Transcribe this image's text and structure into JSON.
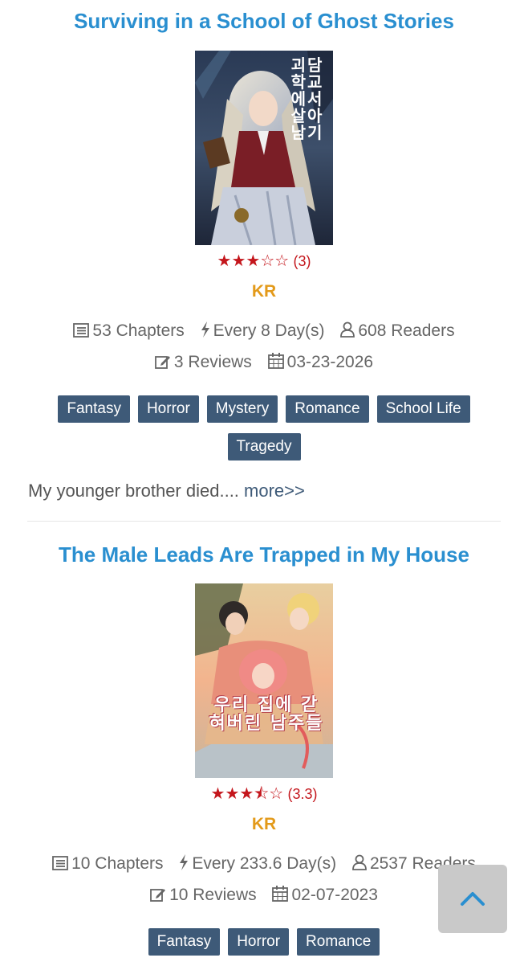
{
  "novels": [
    {
      "title": "Surviving in a School of Ghost Stories",
      "cover_text": "괴담 학교 에서 살아남기",
      "rating_stars": "★★★☆☆",
      "rating_value": "(3)",
      "origin": "KR",
      "chapters": "53 Chapters",
      "frequency": "Every 8 Day(s)",
      "readers": "608 Readers",
      "reviews": "3 Reviews",
      "date": "03-23-2026",
      "tags": [
        "Fantasy",
        "Horror",
        "Mystery",
        "Romance",
        "School Life",
        "Tragedy"
      ],
      "description": "My younger brother died....",
      "more_label": "more>>"
    },
    {
      "title": "The Male Leads Are Trapped in My House",
      "cover_text": "우리 집에 갇혀버린 남주들",
      "rating_stars": "★★★⯪☆",
      "rating_value": "(3.3)",
      "origin": "KR",
      "chapters": "10 Chapters",
      "frequency": "Every 233.6 Day(s)",
      "readers": "2537 Readers",
      "reviews": "10 Reviews",
      "date": "02-07-2023",
      "tags": [
        "Fantasy",
        "Horror",
        "Romance"
      ]
    }
  ],
  "colors": {
    "title": "#2a8fd0",
    "origin": "#e39a1a",
    "stars": "#c4161c",
    "tag_bg": "#3e5a78"
  },
  "icons": [
    "list-icon",
    "bolt-icon",
    "user-icon",
    "edit-icon",
    "calendar-icon",
    "chevron-up-icon"
  ]
}
